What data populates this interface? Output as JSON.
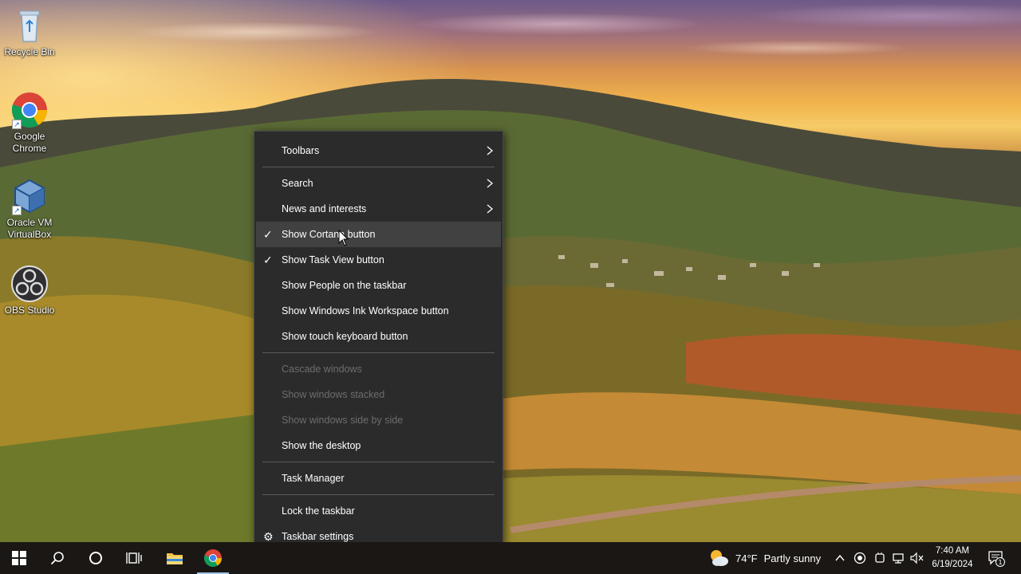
{
  "desktop": {
    "icons": [
      {
        "label": "Recycle Bin",
        "icon": "recycle-bin-icon"
      },
      {
        "label": "Google Chrome",
        "icon": "chrome-icon"
      },
      {
        "label": "Oracle VM VirtualBox",
        "icon": "virtualbox-icon"
      },
      {
        "label": "OBS Studio",
        "icon": "obs-icon"
      }
    ]
  },
  "context_menu": {
    "items": [
      {
        "label": "Toolbars",
        "submenu": true
      },
      {
        "label": "Search",
        "submenu": true
      },
      {
        "label": "News and interests",
        "submenu": true
      },
      {
        "label": "Show Cortana button",
        "checked": true,
        "hovered": true
      },
      {
        "label": "Show Task View button",
        "checked": true
      },
      {
        "label": "Show People on the taskbar"
      },
      {
        "label": "Show Windows Ink Workspace button"
      },
      {
        "label": "Show touch keyboard button"
      },
      {
        "label": "Cascade windows",
        "disabled": true
      },
      {
        "label": "Show windows stacked",
        "disabled": true
      },
      {
        "label": "Show windows side by side",
        "disabled": true
      },
      {
        "label": "Show the desktop"
      },
      {
        "label": "Task Manager"
      },
      {
        "label": "Lock the taskbar"
      },
      {
        "label": "Taskbar settings",
        "icon": "gear-icon"
      }
    ]
  },
  "taskbar": {
    "buttons": [
      {
        "icon": "windows-start-icon"
      },
      {
        "icon": "search-icon"
      },
      {
        "icon": "cortana-icon"
      },
      {
        "icon": "task-view-icon"
      },
      {
        "icon": "file-explorer-icon"
      },
      {
        "icon": "chrome-icon",
        "active": true
      }
    ],
    "weather": {
      "temperature": "74°F",
      "condition": "Partly sunny"
    },
    "clock": {
      "time": "7:40 AM",
      "date": "6/19/2024"
    },
    "notification_count": "1",
    "accent_color": "#9ec3e6"
  }
}
